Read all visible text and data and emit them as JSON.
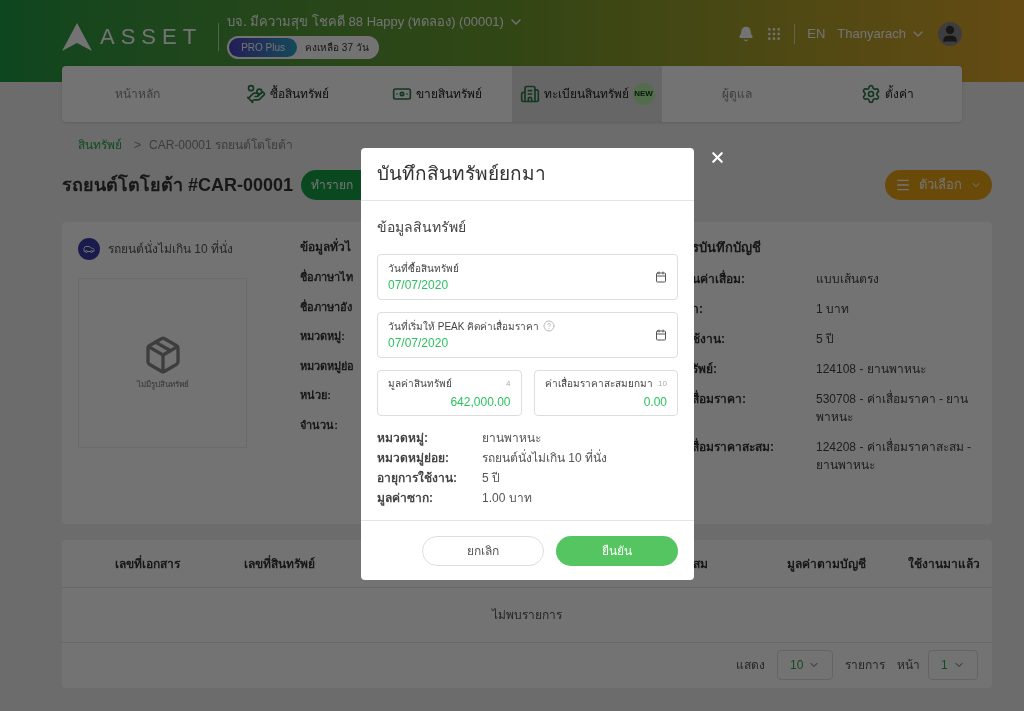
{
  "header": {
    "logo_text": "ASSET",
    "company": "บจ. มีความสุข โชคดี 88 Happy (ทดลอง) (00001)",
    "plan": "PRO Plus",
    "remaining": "คงเหลือ 37 วัน",
    "language": "EN",
    "user": "Thanyarach"
  },
  "nav": [
    {
      "label": "หน้าหลัก",
      "kind": "none",
      "selected": false,
      "disabled": true
    },
    {
      "label": "ซื้อสินทรัพย์",
      "kind": "buy",
      "selected": false,
      "disabled": false
    },
    {
      "label": "ขายสินทรัพย์",
      "kind": "sell",
      "selected": false,
      "disabled": false
    },
    {
      "label": "ทะเบียนสินทรัพย์",
      "kind": "register",
      "selected": true,
      "disabled": false,
      "badge": "NEW"
    },
    {
      "label": "ผู้ดูแล",
      "kind": "none",
      "selected": false,
      "disabled": true
    },
    {
      "label": "ตั้งค่า",
      "kind": "settings",
      "selected": false,
      "disabled": false
    }
  ],
  "breadcrumb": {
    "root": "สินทรัพย์",
    "separator": ">",
    "current": "CAR-00001 รถยนต์โตโยต้า"
  },
  "title": "รถยนต์โตโยต้า #CAR-00001",
  "action_button": "ทำรายก",
  "options_button": "ตัวเลือก",
  "detail": {
    "category": "รถยนต์นั่งไม่เกิน 10 ที่นั่ง",
    "no_image": "ไม่มีรูปสินทรัพย์",
    "general_heading": "ข้อมูลทั่วไ",
    "general_labels": [
      "ชื่อภาษาไท",
      "ชื่อภาษาอัง",
      "หมวดหมู่:",
      "หมวดหมู่ย่อ",
      "หน่วย:",
      "จำนวน:"
    ],
    "accounting_heading": "รบันทึกบัญชี",
    "accounting_rows": [
      {
        "label": "นค่าเสื่อม:",
        "value": "แบบเส้นตรง"
      },
      {
        "label": "า:",
        "value": "1 บาท"
      },
      {
        "label": "ช้งาน:",
        "value": "5 ปี"
      },
      {
        "label": "รัพย์:",
        "value": "124108 - ยานพาหนะ"
      },
      {
        "label": "สื่อมราคา:",
        "value": "530708 - ค่าเสื่อมราคา - ยานพาหนะ"
      },
      {
        "label": "สื่อมราคาสะสม:",
        "value": "124208 - ค่าเสื่อมราคาสะสม - ยานพาหนะ"
      }
    ]
  },
  "table": {
    "columns": [
      "เลขที่เอกสาร",
      "เลขที่สินทรัพย์",
      "สม",
      "มูลค่าตามบัญชี",
      "ใช้งานมาแล้ว"
    ],
    "empty": "ไม่พบรายการ",
    "show_label": "แสดง",
    "page_size": "10",
    "rows_label": "รายการ",
    "page_label": "หน้า",
    "page": "1"
  },
  "modal": {
    "title": "บันทึกสินทรัพย์ยกมา",
    "section": "ข้อมูลสินทรัพย์",
    "fields": [
      {
        "kind": "date",
        "label": "วันที่ซื้อสินทรัพย์",
        "value": "07/07/2020",
        "help": false
      },
      {
        "kind": "date",
        "label": "วันที่เริ่มให้ PEAK คิดค่าเสื่อมราคา",
        "value": "07/07/2020",
        "help": true
      }
    ],
    "amounts": [
      {
        "label": "มูลค่าสินทรัพย์",
        "hint": "4",
        "value": "642,000.00"
      },
      {
        "label": "ค่าเสื่อมราคาสะสมยกมา",
        "hint": "10",
        "value": "0.00"
      }
    ],
    "info": [
      {
        "label": "หมวดหมู่:",
        "value": "ยานพาหนะ"
      },
      {
        "label": "หมวดหมู่ย่อย:",
        "value": "รถยนต์นั่งไม่เกิน 10 ที่นั่ง"
      },
      {
        "label": "อายุการใช้งาน:",
        "value": "5 ปี"
      },
      {
        "label": "มูลค่าซาก:",
        "value": "1.00 บาท"
      }
    ],
    "cancel": "ยกเลิก",
    "confirm": "ยืนยัน"
  }
}
